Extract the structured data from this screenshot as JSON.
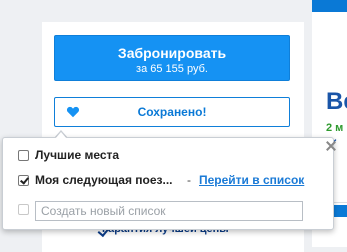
{
  "booking": {
    "book_label": "Забронировать",
    "price_label": "за 65 155 руб.",
    "saved_label": "Сохранено!",
    "guarantee_text": "Гарантия лучшей цены"
  },
  "save_popover": {
    "lists": [
      {
        "label": "Лучшие места",
        "checked": false
      },
      {
        "label": "Моя следующая поез...",
        "checked": true,
        "separator": "-",
        "link": "Перейти в список"
      }
    ],
    "new_list_placeholder": "Создать новый список"
  },
  "side_card": {
    "heading_partial": "Ве",
    "green_partial": "2 м"
  },
  "colors": {
    "primary_blue": "#1592f3",
    "link_blue": "#1a7ad6",
    "heading_blue": "#1a55a8",
    "green": "#2e9a2e"
  }
}
